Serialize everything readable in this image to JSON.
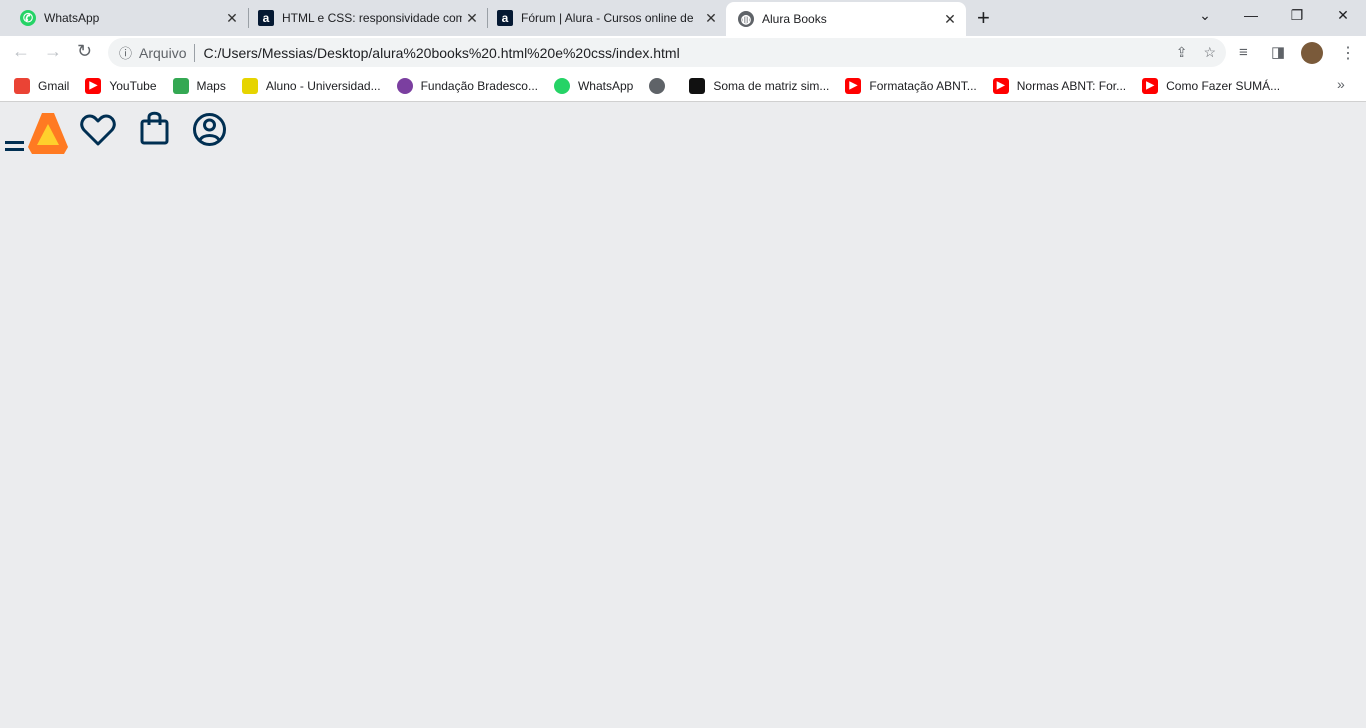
{
  "browser": {
    "tabs": [
      {
        "title": "WhatsApp",
        "icon": "whatsapp-icon"
      },
      {
        "title": "HTML e CSS: responsividade com",
        "icon": "alura-icon"
      },
      {
        "title": "Fórum | Alura - Cursos online de",
        "icon": "alura-icon"
      },
      {
        "title": "Alura Books",
        "icon": "globe-icon",
        "active": true
      }
    ],
    "address": {
      "scheme_label": "Arquivo",
      "url": "C:/Users/Messias/Desktop/alura%20books%20.html%20e%20css/index.html"
    },
    "bookmarks": [
      {
        "label": "Gmail",
        "icon": "gmail-icon",
        "color": "#ea4335"
      },
      {
        "label": "YouTube",
        "icon": "youtube-icon",
        "color": "#ff0000"
      },
      {
        "label": "Maps",
        "icon": "maps-icon",
        "color": "#34a853"
      },
      {
        "label": "Aluno - Universidad...",
        "icon": "university-icon",
        "color": "#e6d400"
      },
      {
        "label": "Fundação Bradesco...",
        "icon": "bradesco-icon",
        "color": "#7b3fa0"
      },
      {
        "label": "WhatsApp",
        "icon": "whatsapp-icon",
        "color": "#25d366"
      },
      {
        "label": "",
        "icon": "globe-icon",
        "color": "#5f6368"
      },
      {
        "label": "Soma de matriz sim...",
        "icon": "site-icon",
        "color": "#111111"
      },
      {
        "label": "Formatação ABNT...",
        "icon": "youtube-icon",
        "color": "#ff0000"
      },
      {
        "label": "Normas ABNT: For...",
        "icon": "youtube-icon",
        "color": "#ff0000"
      },
      {
        "label": "Como Fazer SUMÁ...",
        "icon": "youtube-icon",
        "color": "#ff0000"
      }
    ]
  },
  "page": {
    "header_icons": [
      "menu-icon",
      "alura-logo",
      "heart-icon",
      "shopping-bag-icon",
      "user-icon"
    ],
    "icon_color": "#002f52",
    "logo_colors": [
      "#ff7a22",
      "#ffd02c"
    ]
  }
}
